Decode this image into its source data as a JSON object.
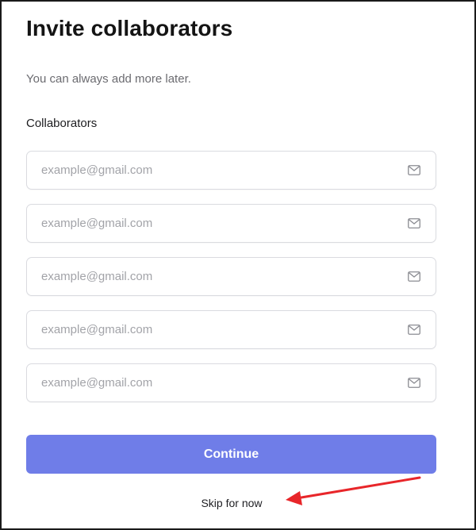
{
  "header": {
    "title": "Invite collaborators",
    "subtitle": "You can always add more later."
  },
  "collaborators": {
    "label": "Collaborators",
    "fields": [
      {
        "placeholder": "example@gmail.com",
        "value": "",
        "icon": "mail-icon"
      },
      {
        "placeholder": "example@gmail.com",
        "value": "",
        "icon": "mail-icon"
      },
      {
        "placeholder": "example@gmail.com",
        "value": "",
        "icon": "mail-icon"
      },
      {
        "placeholder": "example@gmail.com",
        "value": "",
        "icon": "mail-icon"
      },
      {
        "placeholder": "example@gmail.com",
        "value": "",
        "icon": "mail-icon"
      }
    ]
  },
  "actions": {
    "continue_label": "Continue",
    "skip_label": "Skip for now"
  },
  "annotation": {
    "arrow_color": "#e8262a",
    "points_to": "skip-for-now-link"
  },
  "colors": {
    "accent": "#6f7de8",
    "field_border": "#dadbe0",
    "placeholder": "#a2a3a8"
  }
}
